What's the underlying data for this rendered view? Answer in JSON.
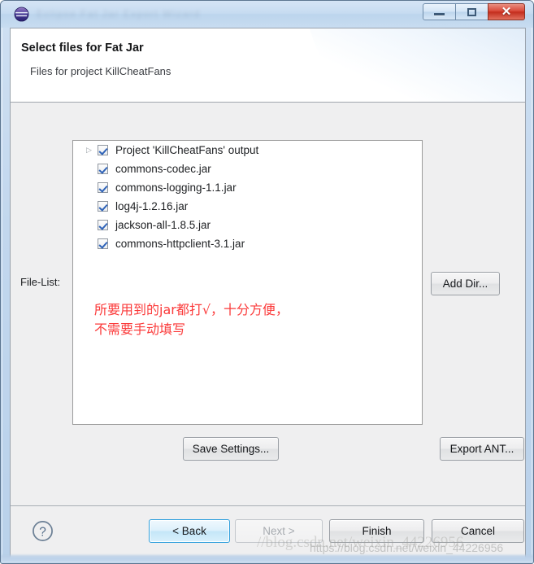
{
  "window": {
    "title_ghost": "Eclipse  Fat  Jar  Export  Wizard",
    "icon": "eclipse-globe-icon",
    "controls": {
      "minimize": "minimize-icon",
      "maximize": "maximize-icon",
      "close": "✕"
    }
  },
  "header": {
    "title": "Select files for Fat Jar",
    "description": "Files for project KillCheatFans"
  },
  "body": {
    "file_list_caption": "File-List:",
    "file_list": [
      {
        "label": "Project 'KillCheatFans' output",
        "checked": true,
        "expandable": true
      },
      {
        "label": "commons-codec.jar",
        "checked": true,
        "expandable": false
      },
      {
        "label": "commons-logging-1.1.jar",
        "checked": true,
        "expandable": false
      },
      {
        "label": "log4j-1.2.16.jar",
        "checked": true,
        "expandable": false
      },
      {
        "label": "jackson-all-1.8.5.jar",
        "checked": true,
        "expandable": false
      },
      {
        "label": "commons-httpclient-3.1.jar",
        "checked": true,
        "expandable": false
      }
    ],
    "annotation": {
      "text": "所要用到的jar都打√，十分方便，\n不需要手动填写",
      "color": "#fb3a3a"
    },
    "buttons": {
      "add_dir": "Add Dir...",
      "save_settings": "Save Settings...",
      "export_ant": "Export ANT..."
    }
  },
  "footer": {
    "help": "?",
    "back": "< Back",
    "next": "Next >",
    "finish": "Finish",
    "cancel": "Cancel"
  },
  "watermarks": {
    "top": "//blog.csdn.net/weixin_44226956",
    "bottom": "https://blog.csdn.net/weixin_44226956"
  }
}
